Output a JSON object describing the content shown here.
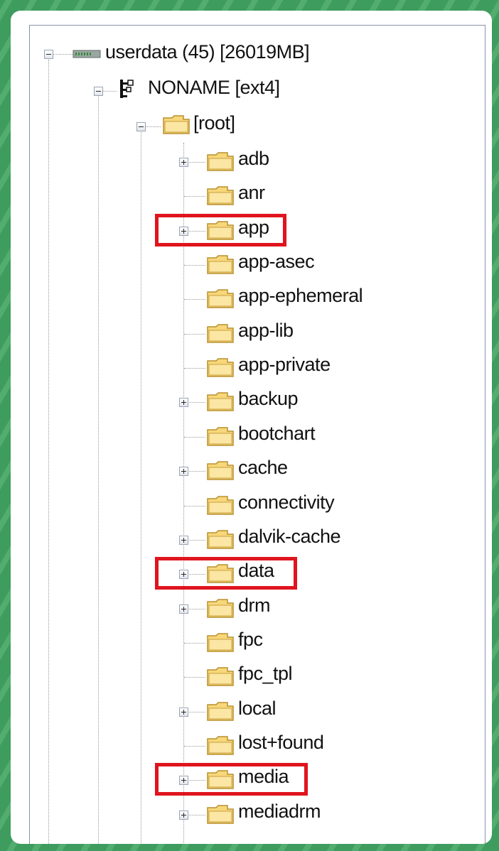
{
  "tree": {
    "root_drive": {
      "label": "userdata (45) [26019MB]",
      "expanded": true,
      "icon": "drive-icon"
    },
    "partition": {
      "label": "NONAME [ext4]",
      "expanded": true,
      "icon": "filesystem-icon"
    },
    "root_folder": {
      "label": "[root]",
      "expanded": true,
      "icon": "folder-icon"
    },
    "folders": [
      {
        "label": "adb",
        "expandable": true,
        "highlighted": false
      },
      {
        "label": "anr",
        "expandable": false,
        "highlighted": false
      },
      {
        "label": "app",
        "expandable": true,
        "highlighted": true
      },
      {
        "label": "app-asec",
        "expandable": false,
        "highlighted": false
      },
      {
        "label": "app-ephemeral",
        "expandable": false,
        "highlighted": false
      },
      {
        "label": "app-lib",
        "expandable": false,
        "highlighted": false
      },
      {
        "label": "app-private",
        "expandable": false,
        "highlighted": false
      },
      {
        "label": "backup",
        "expandable": true,
        "highlighted": false
      },
      {
        "label": "bootchart",
        "expandable": false,
        "highlighted": false
      },
      {
        "label": "cache",
        "expandable": true,
        "highlighted": false
      },
      {
        "label": "connectivity",
        "expandable": false,
        "highlighted": false
      },
      {
        "label": "dalvik-cache",
        "expandable": true,
        "highlighted": false
      },
      {
        "label": "data",
        "expandable": true,
        "highlighted": true
      },
      {
        "label": "drm",
        "expandable": true,
        "highlighted": false
      },
      {
        "label": "fpc",
        "expandable": false,
        "highlighted": false
      },
      {
        "label": "fpc_tpl",
        "expandable": false,
        "highlighted": false
      },
      {
        "label": "local",
        "expandable": true,
        "highlighted": false
      },
      {
        "label": "lost+found",
        "expandable": false,
        "highlighted": false
      },
      {
        "label": "media",
        "expandable": true,
        "highlighted": true
      },
      {
        "label": "mediadrm",
        "expandable": true,
        "highlighted": false
      }
    ]
  },
  "colors": {
    "highlight": "#e0141e",
    "background_green": "#3e9c5e",
    "folder_fill": "#f7d77a",
    "folder_stroke": "#b8902e"
  }
}
